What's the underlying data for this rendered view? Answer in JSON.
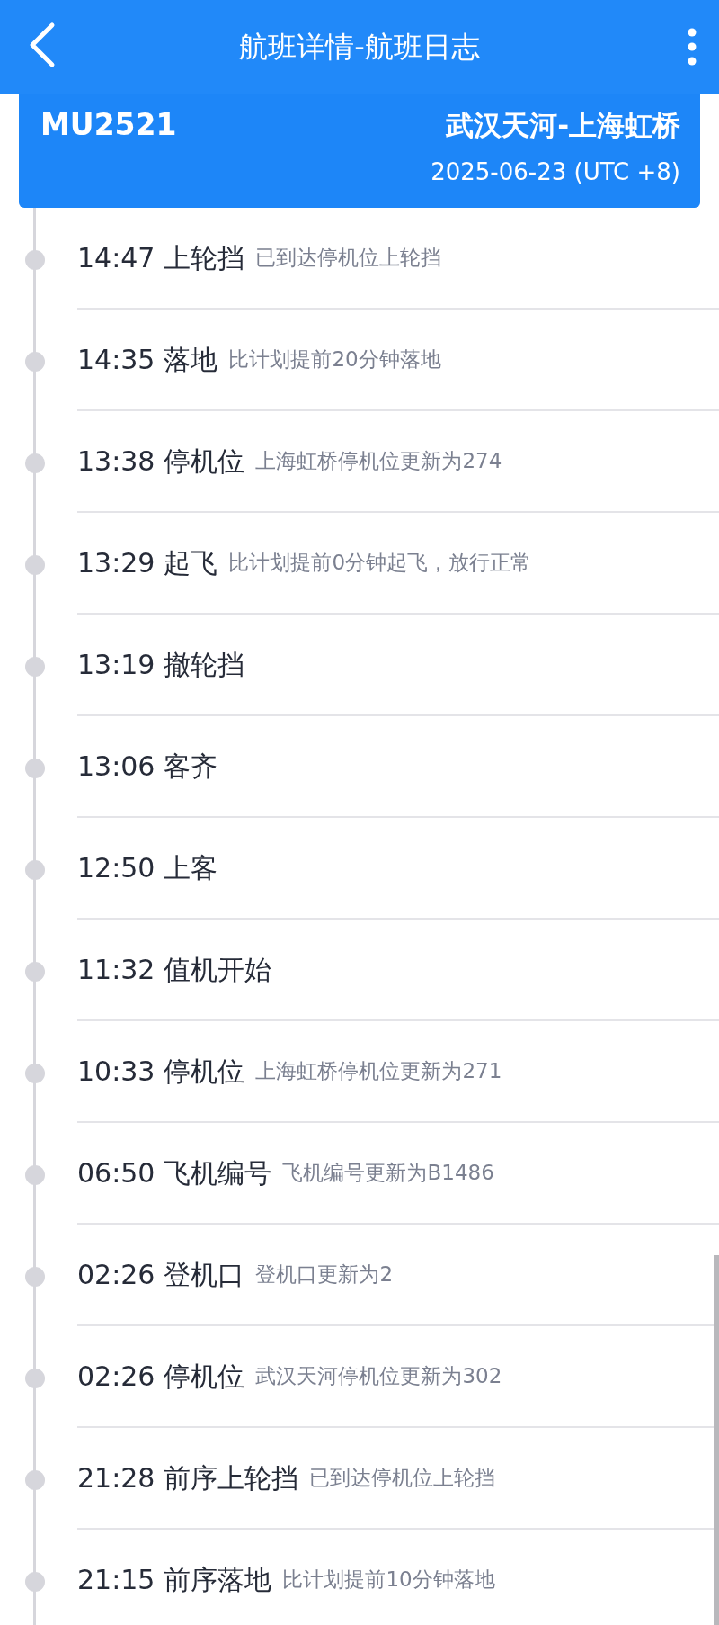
{
  "header": {
    "title": "航班详情-航班日志"
  },
  "flight": {
    "number": "MU2521",
    "route": "武汉天河-上海虹桥",
    "date": "2025-06-23 (UTC +8)"
  },
  "log": [
    {
      "time": "14:47",
      "event": "上轮挡",
      "detail": "已到达停机位上轮挡"
    },
    {
      "time": "14:35",
      "event": "落地",
      "detail": "比计划提前20分钟落地"
    },
    {
      "time": "13:38",
      "event": "停机位",
      "detail": "上海虹桥停机位更新为274"
    },
    {
      "time": "13:29",
      "event": "起飞",
      "detail": "比计划提前0分钟起飞，放行正常"
    },
    {
      "time": "13:19",
      "event": "撤轮挡"
    },
    {
      "time": "13:06",
      "event": "客齐"
    },
    {
      "time": "12:50",
      "event": "上客"
    },
    {
      "time": "11:32",
      "event": "值机开始"
    },
    {
      "time": "10:33",
      "event": "停机位",
      "detail": "上海虹桥停机位更新为271"
    },
    {
      "time": "06:50",
      "event": "飞机编号",
      "detail": "飞机编号更新为B1486"
    },
    {
      "time": "02:26",
      "event": "登机口",
      "detail": "登机口更新为2"
    },
    {
      "time": "02:26",
      "event": "停机位",
      "detail": "武汉天河停机位更新为302"
    },
    {
      "time": "21:28",
      "event": "前序上轮挡",
      "detail": "已到达停机位上轮挡"
    },
    {
      "time": "21:15",
      "event": "前序落地",
      "detail": "比计划提前10分钟落地"
    }
  ]
}
